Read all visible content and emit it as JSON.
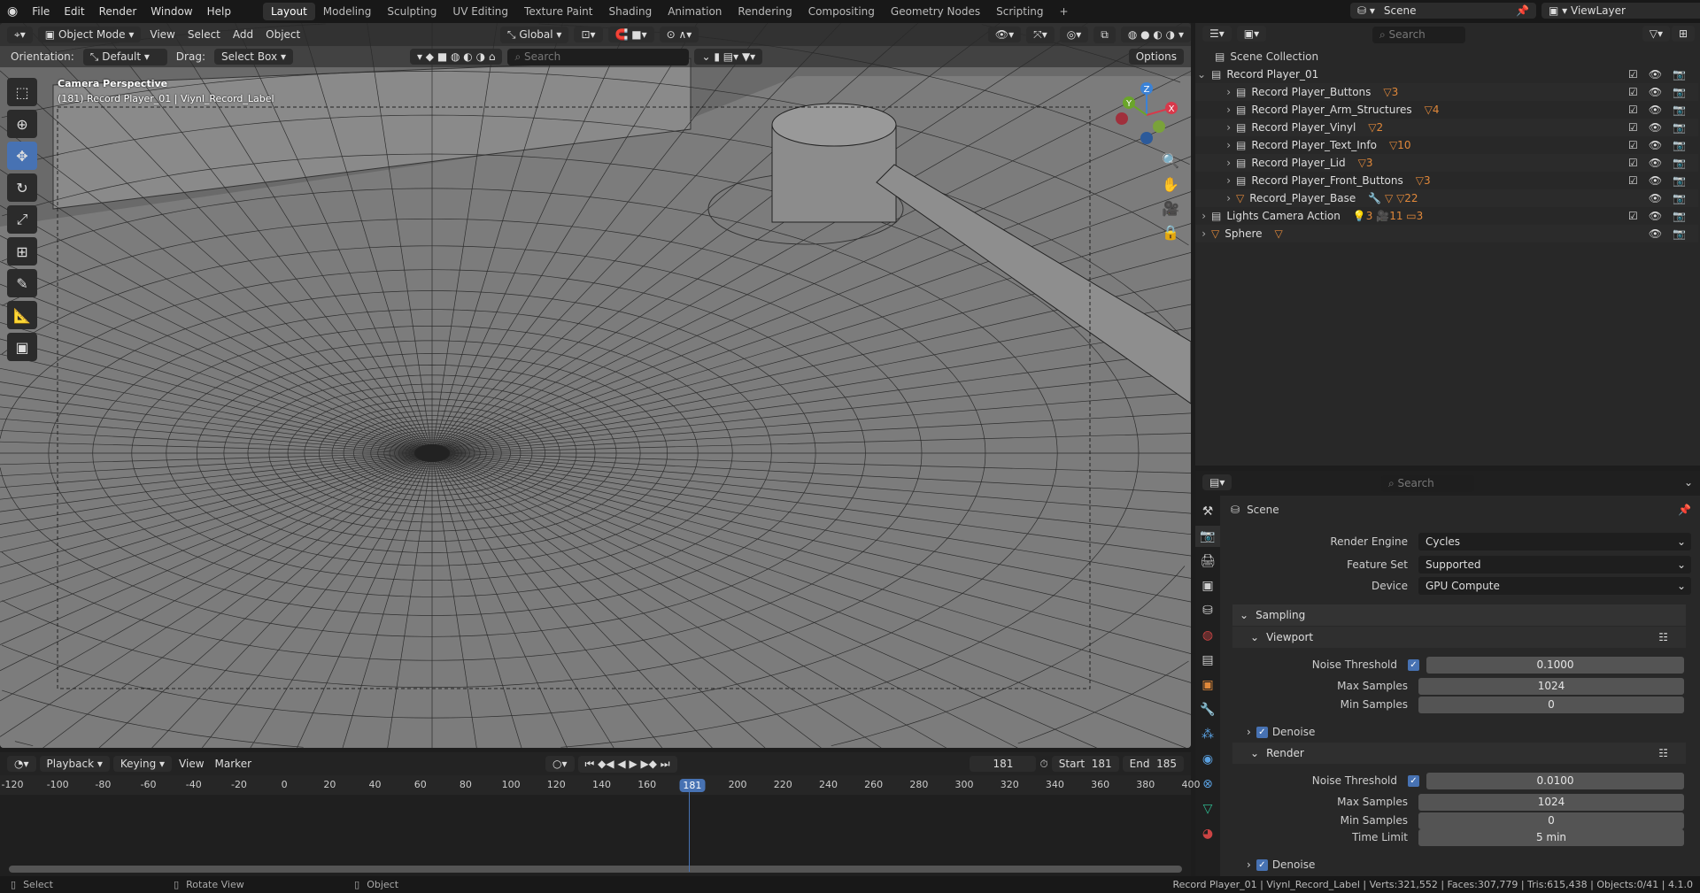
{
  "topbar": {
    "menus": [
      "File",
      "Edit",
      "Render",
      "Window",
      "Help"
    ],
    "workspaces": [
      "Layout",
      "Modeling",
      "Sculpting",
      "UV Editing",
      "Texture Paint",
      "Shading",
      "Animation",
      "Rendering",
      "Compositing",
      "Geometry Nodes",
      "Scripting"
    ],
    "active_workspace": "Layout",
    "add": "+",
    "scene": "Scene",
    "view_layer": "ViewLayer"
  },
  "viewport": {
    "mode": "Object Mode",
    "menus": [
      "View",
      "Select",
      "Add",
      "Object"
    ],
    "transform": "Global",
    "orientation_label": "Orientation:",
    "orientation": "Default",
    "drag_label": "Drag:",
    "drag": "Select Box",
    "search_placeholder": "Search",
    "options": "Options",
    "overlay_title": "Camera Perspective",
    "overlay_sub": "(181) Record Player_01 | Viynl_Record_Label",
    "gizmo": {
      "z": "Z",
      "y": "Y",
      "x": "X"
    }
  },
  "outliner": {
    "search_placeholder": "Search",
    "root": "Scene Collection",
    "items": [
      {
        "name": "Record Player_01",
        "depth": 0,
        "type": "collection",
        "open": true,
        "badges": "",
        "checkbox": true
      },
      {
        "name": "Record Player_Buttons",
        "depth": 1,
        "type": "collection",
        "badges": "▽3",
        "checkbox": true
      },
      {
        "name": "Record Player_Arm_Structures",
        "depth": 1,
        "type": "collection",
        "badges": "▽4",
        "checkbox": true
      },
      {
        "name": "Record Player_Vinyl",
        "depth": 1,
        "type": "collection",
        "badges": "▽2",
        "checkbox": true
      },
      {
        "name": "Record Player_Text_Info",
        "depth": 1,
        "type": "collection",
        "badges": "▽10",
        "checkbox": true
      },
      {
        "name": "Record Player_Lid",
        "depth": 1,
        "type": "collection",
        "badges": "▽3",
        "checkbox": true
      },
      {
        "name": "Record Player_Front_Buttons",
        "depth": 1,
        "type": "collection",
        "badges": "▽3",
        "checkbox": true
      },
      {
        "name": "Record_Player_Base",
        "depth": 1,
        "type": "object",
        "badges": "🔧 ▽ ▽22",
        "checkbox": false
      },
      {
        "name": "Lights Camera Action",
        "depth": 0,
        "type": "collection",
        "badges": "💡3 🎥11 ▭3",
        "checkbox": true
      },
      {
        "name": "Sphere",
        "depth": 0,
        "type": "object",
        "badges": "▽",
        "checkbox": false
      }
    ]
  },
  "properties": {
    "search_placeholder": "Search",
    "context": "Scene",
    "render_engine_label": "Render Engine",
    "render_engine": "Cycles",
    "feature_set_label": "Feature Set",
    "feature_set": "Supported",
    "device_label": "Device",
    "device": "GPU Compute",
    "sampling": "Sampling",
    "viewport": {
      "title": "Viewport",
      "noise_label": "Noise Threshold",
      "noise": "0.1000",
      "max_label": "Max Samples",
      "max": "1024",
      "min_label": "Min Samples",
      "min": "0",
      "denoise": "Denoise"
    },
    "render": {
      "title": "Render",
      "noise_label": "Noise Threshold",
      "noise": "0.0100",
      "max_label": "Max Samples",
      "max": "1024",
      "min_label": "Min Samples",
      "min": "0",
      "time_label": "Time Limit",
      "time": "5 min",
      "denoise": "Denoise"
    }
  },
  "timeline": {
    "menus": [
      "Playback",
      "Keying",
      "View",
      "Marker"
    ],
    "current_frame": "181",
    "start_label": "Start",
    "start": "181",
    "end_label": "End",
    "end": "185",
    "ticks": [
      "-120",
      "-100",
      "-80",
      "-60",
      "-40",
      "-20",
      "0",
      "20",
      "40",
      "60",
      "80",
      "100",
      "120",
      "140",
      "160",
      "181",
      "200",
      "220",
      "240",
      "260",
      "280",
      "300",
      "320",
      "340",
      "360",
      "380",
      "400"
    ]
  },
  "status": {
    "select": "Select",
    "rotate": "Rotate View",
    "object": "Object",
    "info": "Record Player_01 | Viynl_Record_Label | Verts:321,552 | Faces:307,779 | Tris:615,438 | Objects:0/41 | 4.1.0"
  }
}
